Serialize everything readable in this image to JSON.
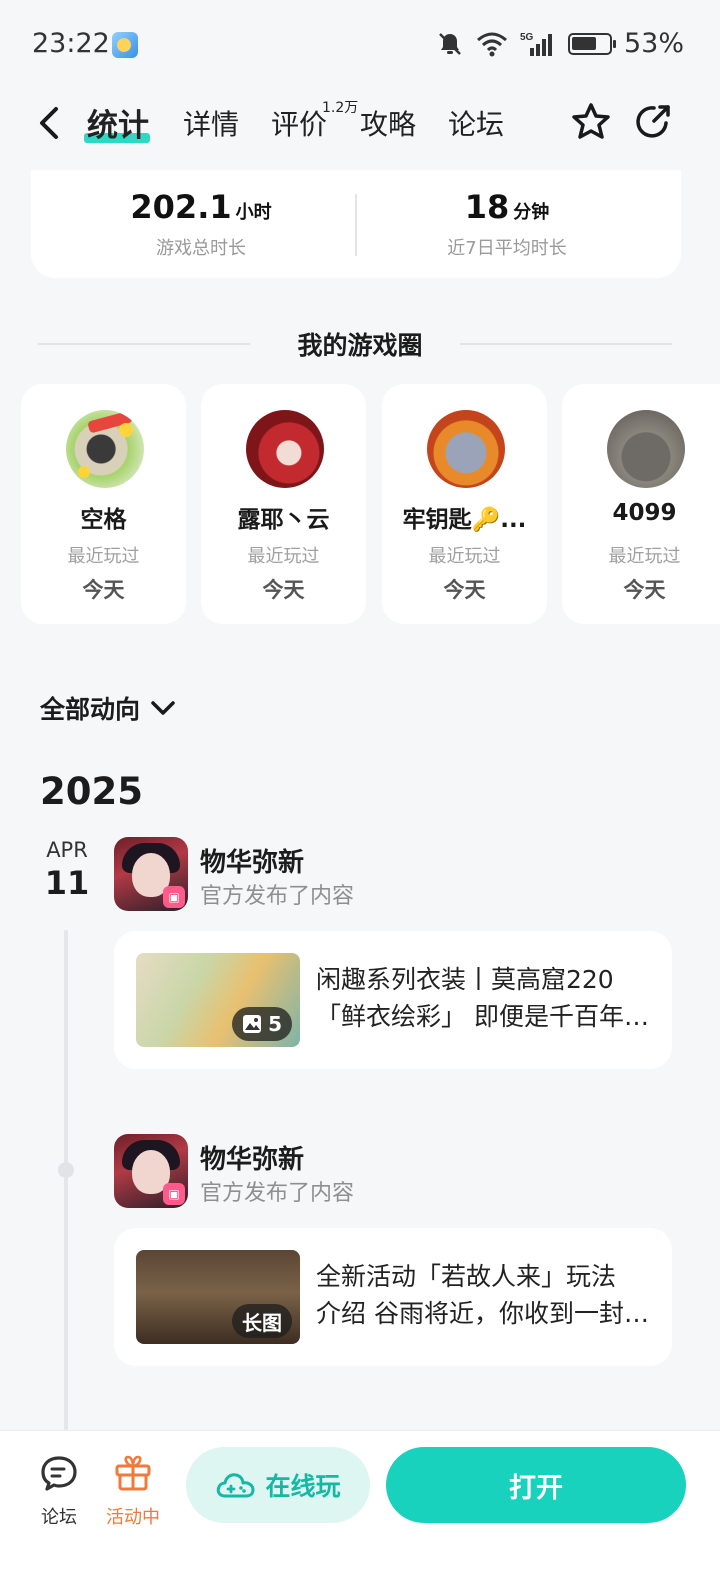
{
  "status_bar": {
    "time": "23:22",
    "battery": "53%",
    "network": "5G"
  },
  "nav": {
    "tabs": [
      {
        "label": "统计",
        "active": true
      },
      {
        "label": "详情"
      },
      {
        "label": "评价",
        "superscript": "1.2万"
      },
      {
        "label": "攻略"
      },
      {
        "label": "论坛"
      }
    ],
    "accent": "#2dd8c4"
  },
  "stats": [
    {
      "value": "202.1",
      "unit": "小时",
      "label": "游戏总时长"
    },
    {
      "value": "18",
      "unit": "分钟",
      "label": "近7日平均时长"
    }
  ],
  "circle": {
    "title": "我的游戏圈",
    "friends": [
      {
        "name": "空格",
        "sub": "最近玩过",
        "day": "今天"
      },
      {
        "name": "露耶丶云",
        "sub": "最近玩过",
        "day": "今天"
      },
      {
        "name": "牢钥匙🔑...",
        "sub": "最近玩过",
        "day": "今天"
      },
      {
        "name": "4099",
        "sub": "最近玩过",
        "day": "今天"
      }
    ]
  },
  "feed": {
    "filter_label": "全部动向",
    "year": "2025",
    "date": {
      "month": "APR",
      "day": "11"
    },
    "posts": [
      {
        "author": "物华弥新",
        "action": "官方发布了内容",
        "line1": "闲趣系列衣装丨莫高窟220",
        "line2": "「鲜衣绘彩」 即便是千百年前的...",
        "chip": "5"
      },
      {
        "author": "物华弥新",
        "action": "官方发布了内容",
        "line1": "全新活动「若故人来」玩法",
        "line2": "介绍 谷雨将近，你收到一封来信...",
        "chip": "长图"
      }
    ]
  },
  "bottom": {
    "forum_label": "论坛",
    "event_label": "活动中",
    "online_label": "在线玩",
    "open_label": "打开",
    "event_color": "#f07a3a"
  }
}
